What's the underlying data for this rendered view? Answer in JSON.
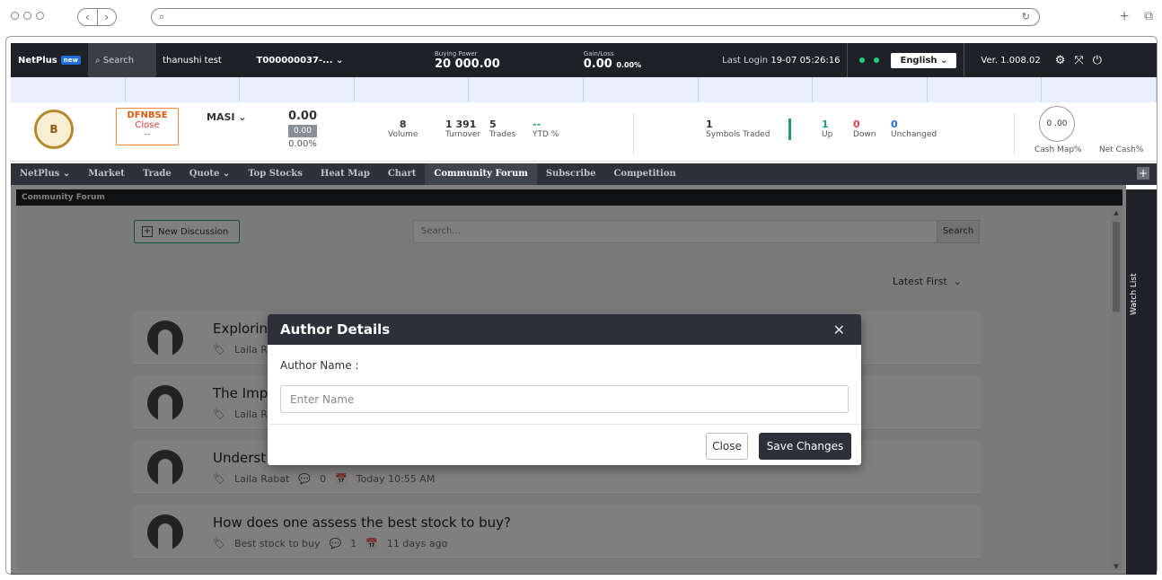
{
  "topbar": {
    "brand": "NetPlus",
    "new_badge": "new",
    "search": "Search",
    "user": "thanushi test",
    "account": "T000000037-...",
    "buying_power_label": "Buying Power",
    "buying_power_value": "20 000.00",
    "gain_loss_label": "Gain/Loss",
    "gain_loss_value": "0.00",
    "gain_loss_pct": "0.00%",
    "last_login_label": "Last Login",
    "last_login_value": "19-07 05:26:16",
    "language": "English",
    "version": "Ver. 1.008.02",
    "status_color": "#1dd37a"
  },
  "index": {
    "market_code": "DFNBSE",
    "market_status": "Close",
    "market_sub": "--",
    "index_name": "MASI",
    "index_value": "0.00",
    "index_change": "0.00",
    "index_pct": "0.00%",
    "volume": {
      "n": "8",
      "l": "Volume"
    },
    "turnover": {
      "n": "1 391",
      "l": "Turnover"
    },
    "trades": {
      "n": "5",
      "l": "Trades"
    },
    "ytd": {
      "n": "--",
      "l": "YTD %"
    },
    "symbols_traded": {
      "n": "1",
      "l": "Symbols Traded"
    },
    "up": {
      "n": "1",
      "l": "Up"
    },
    "down": {
      "n": "0",
      "l": "Down"
    },
    "unchanged": {
      "n": "0",
      "l": "Unchanged"
    },
    "cash_circle": "0 .00",
    "cash_map_label": "Cash Map%",
    "net_cash_label": "Net Cash%"
  },
  "nav": [
    "NetPlus ⌄",
    "Market",
    "Trade",
    "Quote ⌄",
    "Top Stocks",
    "Heat Map",
    "Chart",
    "Community Forum",
    "Subscribe",
    "Competition"
  ],
  "forum": {
    "header": "Community Forum",
    "new_discussion": "New Discussion",
    "search_placeholder": "Search...",
    "search_button": "Search",
    "sort": "Latest First",
    "watch_list": "Watch List",
    "posts": [
      {
        "title": "Explorin",
        "tag": "Laila Ra",
        "comments": "",
        "date": ""
      },
      {
        "title": "The Imp",
        "tag": "Laila Ra",
        "comments": "",
        "date": ""
      },
      {
        "title": "Underst",
        "tag": "Laila Rabat",
        "comments": "0",
        "date": "Today 10:55 AM"
      },
      {
        "title": "How does one assess the best stock to buy?",
        "tag": "Best stock to buy",
        "comments": "1",
        "date": "11 days ago"
      }
    ]
  },
  "modal": {
    "title": "Author Details",
    "label": "Author Name :",
    "placeholder": "Enter Name",
    "close": "Close",
    "save": "Save Changes"
  }
}
